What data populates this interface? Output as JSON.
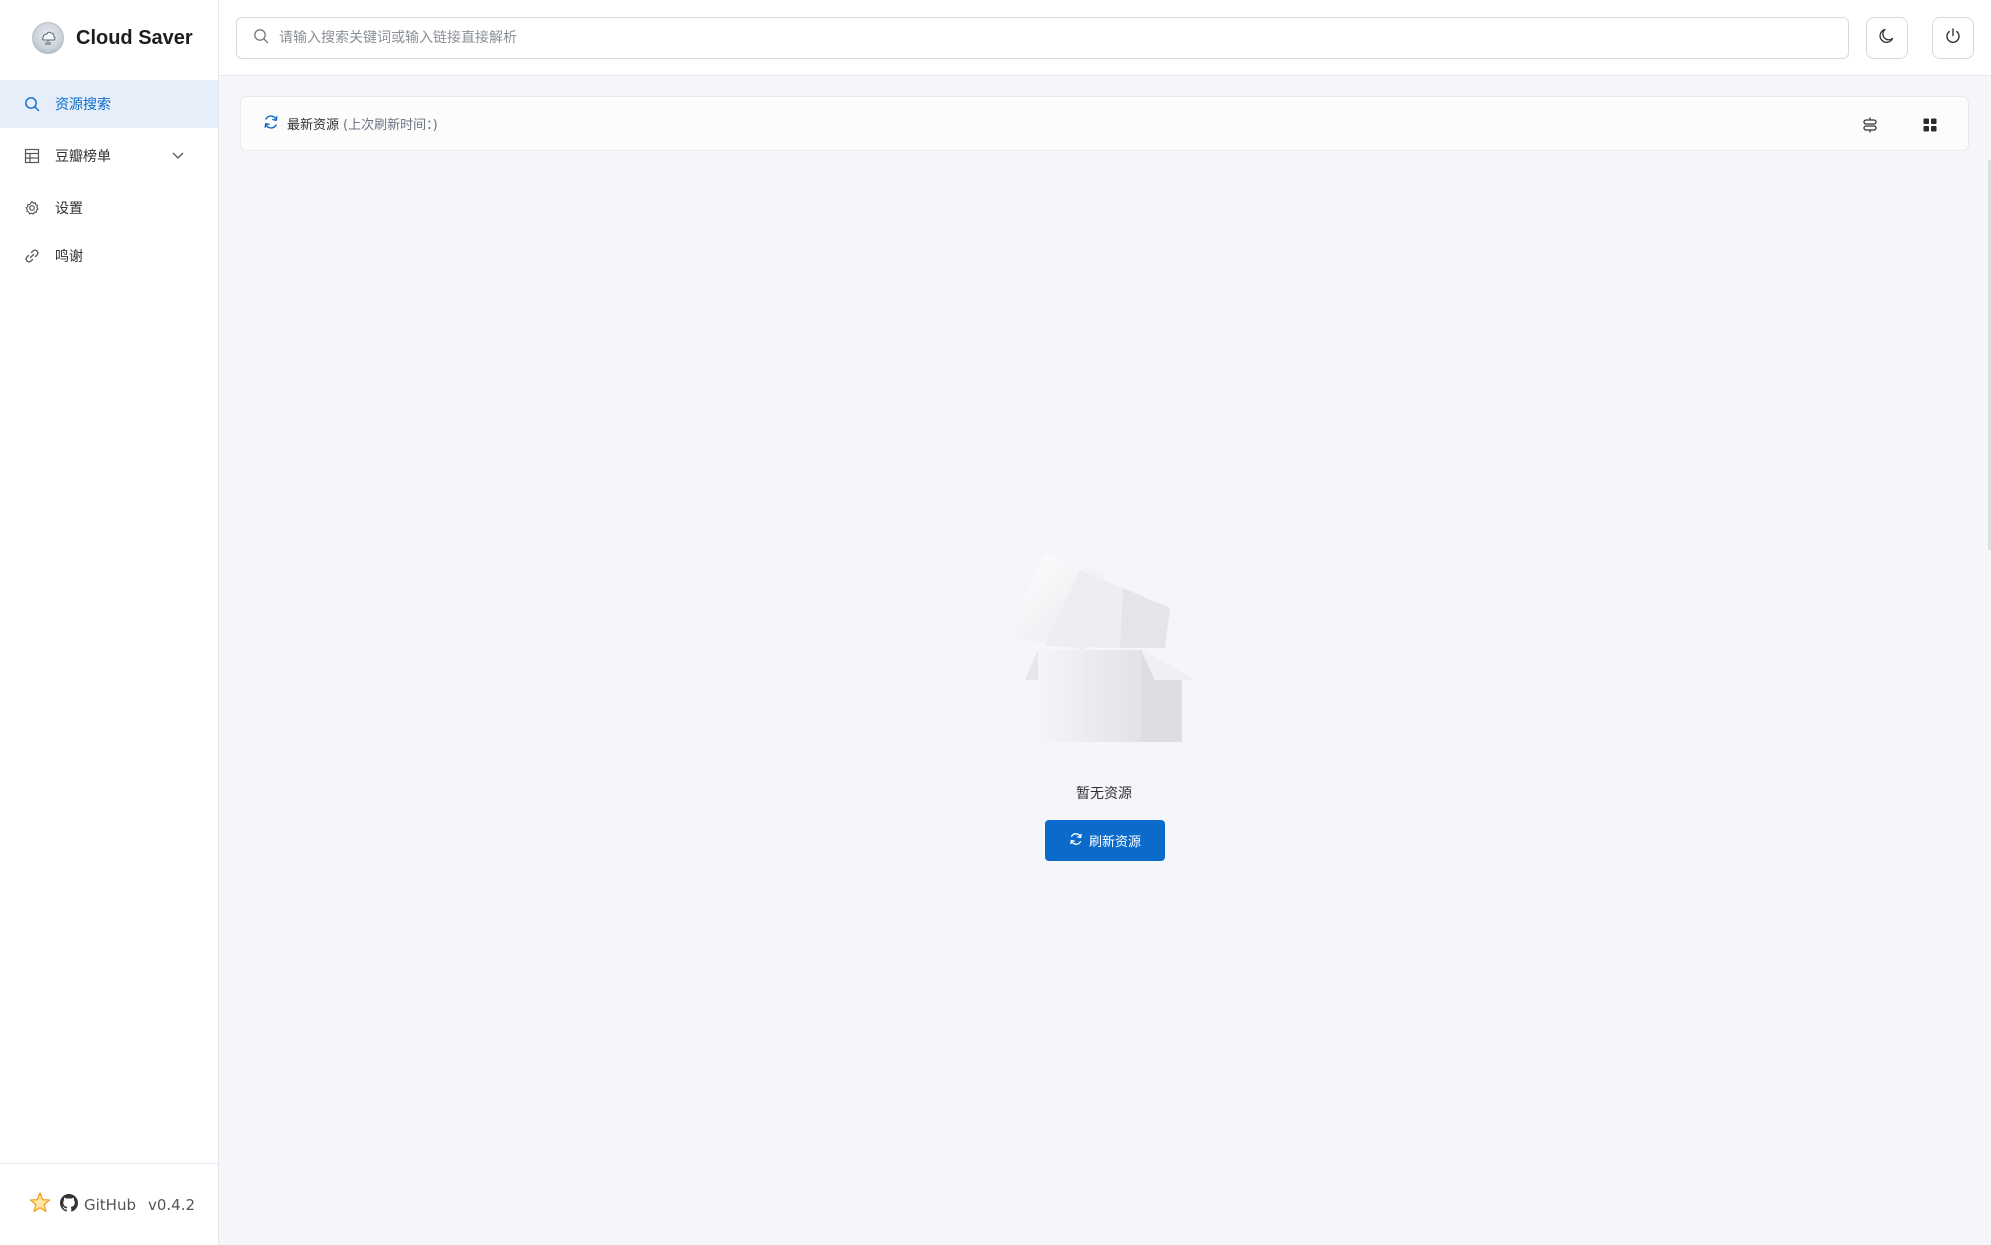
{
  "app": {
    "title": "Cloud Saver",
    "version": "v0.4.2"
  },
  "sidebar": {
    "items": [
      {
        "label": "资源搜索",
        "icon": "search-icon",
        "active": true
      },
      {
        "label": "豆瓣榜单",
        "icon": "table-icon",
        "has_submenu": true
      },
      {
        "label": "设置",
        "icon": "gear-icon"
      },
      {
        "label": "鸣谢",
        "icon": "link-icon"
      }
    ],
    "footer": {
      "github_label": "GitHub",
      "version": "v0.4.2"
    }
  },
  "topbar": {
    "search_placeholder": "请输入搜索关键词或输入链接直接解析",
    "theme_icon": "moon-icon",
    "power_icon": "power-icon"
  },
  "content_header": {
    "title": "最新资源",
    "refresh_time_text": "(上次刷新时间：)"
  },
  "empty_state": {
    "text": "暂无资源",
    "button_label": "刷新资源"
  },
  "colors": {
    "accent": "#0b6bcb",
    "active_bg": "#e6eff9",
    "page_bg": "#f5f6fa"
  }
}
